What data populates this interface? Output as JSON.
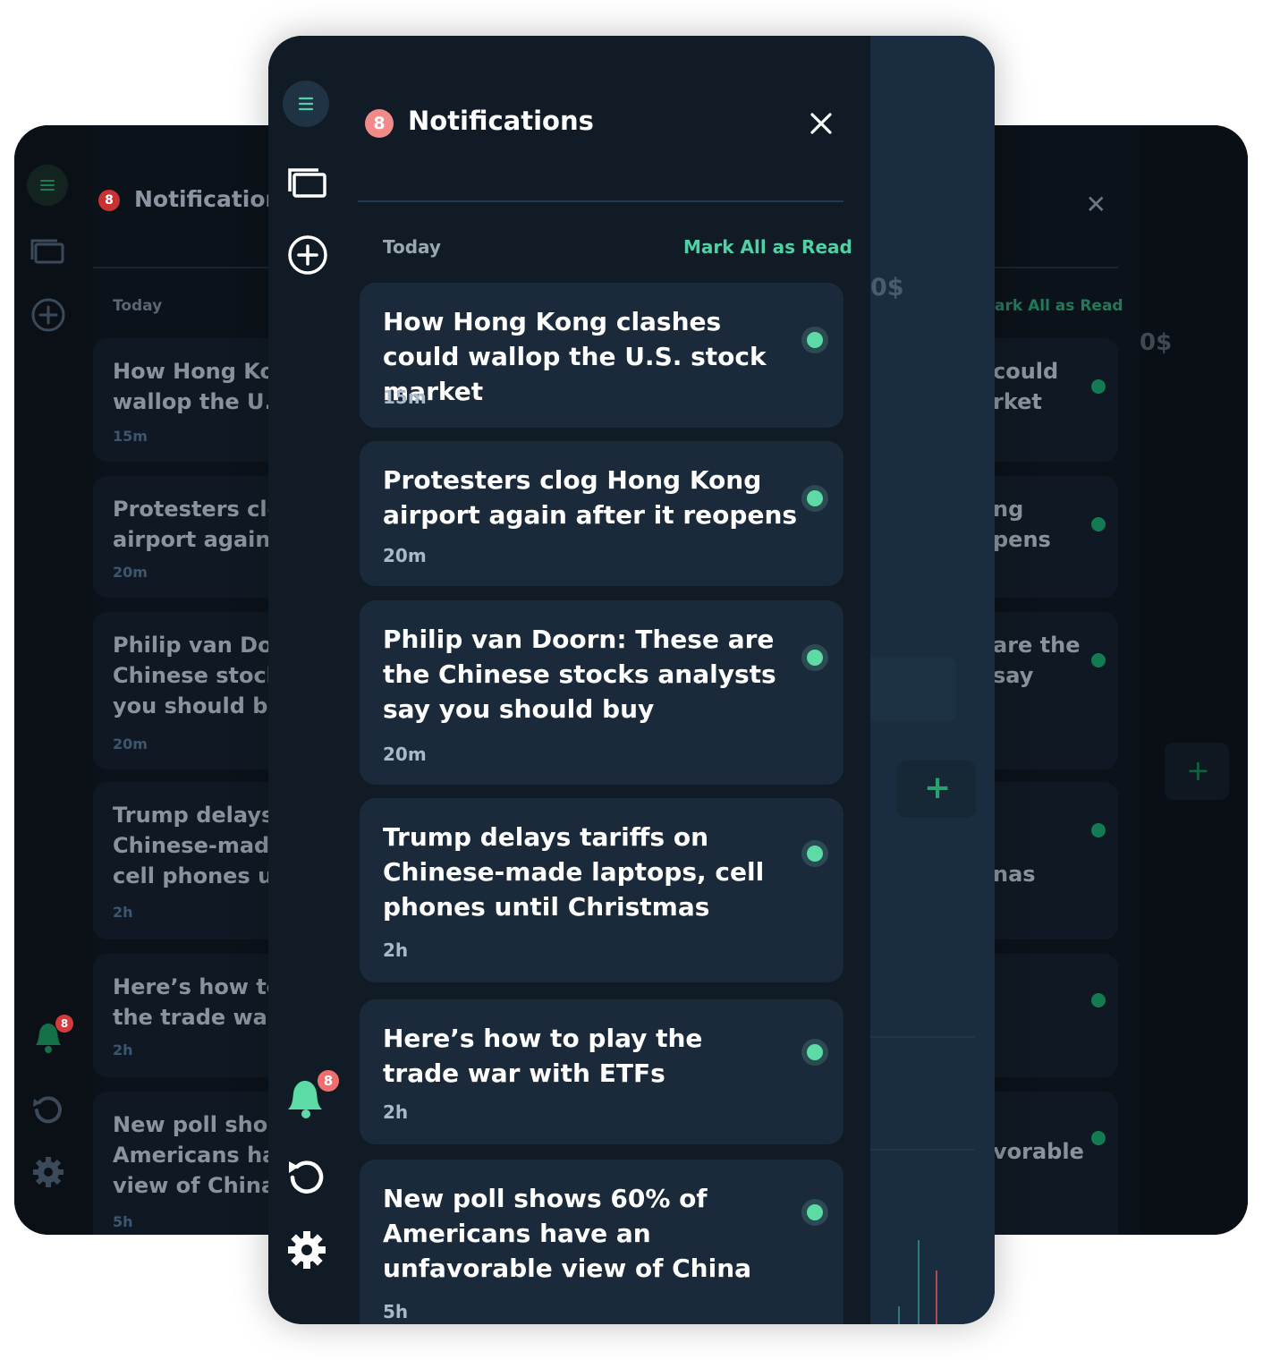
{
  "notifications": {
    "badge_count": "8",
    "title": "Notifications",
    "section_label": "Today",
    "mark_all_label": "Mark All as Read",
    "items": [
      {
        "title": "How Hong Kong clashes could wallop the U.S. stock market",
        "time": "15m",
        "unread": true
      },
      {
        "title": "Protesters clog Hong Kong airport again after it reopens",
        "time": "20m",
        "unread": true
      },
      {
        "title": "Philip van Doorn: These are the Chinese stocks analysts say you should buy",
        "time": "20m",
        "unread": true
      },
      {
        "title": "Trump delays tariffs on Chinese-made laptops, cell phones until Christmas",
        "time": "2h",
        "unread": true
      },
      {
        "title": "Here’s how to play the trade war with ETFs",
        "time": "2h",
        "unread": true
      },
      {
        "title": "New poll shows 60% of Americans have an unfavorable view of China",
        "time": "5h",
        "unread": true
      }
    ]
  },
  "back_panel": {
    "badge_count": "8",
    "title": "Notifications",
    "section_label": "Today",
    "mark_all_label": "ark All as Read",
    "items": [
      {
        "left": "How Hong Kor\nwallop the U.S",
        "right": "could\nrket",
        "time": "15m"
      },
      {
        "left": "Protesters clo\nairport again a",
        "right": "ng\npens",
        "time": "20m"
      },
      {
        "left": "Philip van Doo\nChinese stock\nyou should bu",
        "right": "are the\nsay",
        "time": "20m"
      },
      {
        "left": "Trump delays \nChinese-made\ncell phones ur",
        "right": "\nnas",
        "time": "2h"
      },
      {
        "left": "Here’s how to\nthe trade war ",
        "right": "",
        "time": "2h"
      },
      {
        "left": "New poll show\nAmericans ha\nview of China",
        "right": "vorable",
        "time": "5h"
      }
    ]
  },
  "background_fragments": {
    "dollar_text": "0$",
    "plus_symbol": "+"
  },
  "sidebar": {
    "icons": [
      "menu-icon",
      "screens-icon",
      "add-circle-icon",
      "bell-icon",
      "refresh-icon",
      "gear-icon"
    ],
    "bell_badge": "8"
  },
  "colors": {
    "accent": "#4fd1a5",
    "badge": "#f28a8a",
    "card_bg": "#1a2a3a",
    "panel_bg": "#111b26"
  }
}
